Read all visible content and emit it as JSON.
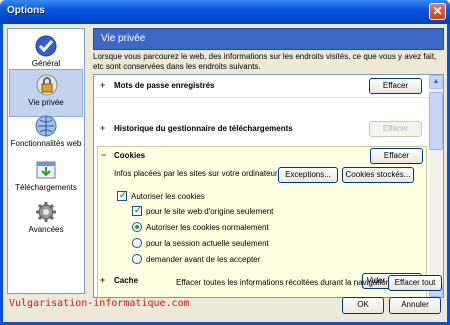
{
  "window": {
    "title": "Options",
    "close_glyph": "✕"
  },
  "sidebar": {
    "items": [
      {
        "label": "Général",
        "icon": "checkmark-icon",
        "selected": false
      },
      {
        "label": "Vie privée",
        "icon": "lock-icon",
        "selected": true
      },
      {
        "label": "Fonctionnalités web",
        "icon": "globe-icon",
        "selected": false
      },
      {
        "label": "Téléchargements",
        "icon": "download-icon",
        "selected": false
      },
      {
        "label": "Avancées",
        "icon": "gear-icon",
        "selected": false
      }
    ]
  },
  "header": {
    "title": "Vie privée"
  },
  "description": "Lorsque vous parcourez le web, des informations sur les endroits visités, ce que vous y avez fait, etc sont conservées dans les endroits suivants.",
  "sections": {
    "passwords": {
      "expander": "+",
      "title": "Mots de passe enregistrés",
      "button": "Effacer"
    },
    "downloads": {
      "expander": "+",
      "title": "Historique du gestionnaire de téléchargements",
      "button": "Effacer"
    },
    "cookies": {
      "expander": "−",
      "title": "Cookies",
      "button": "Effacer",
      "info": "Infos placées par les sites sur votre ordinateur",
      "exceptions_button": "Exceptions...",
      "stored_button": "Cookies stockés...",
      "allow_label": "Autoriser les cookies",
      "origin_label": "pour le site web d'origine seulement",
      "radio_normal": "Autoriser les cookies normalement",
      "radio_session": "pour la session actuelle seulement",
      "radio_ask": "demander avant de les accepter"
    },
    "cache": {
      "expander": "+",
      "title": "Cache",
      "button": "Vider le cache"
    }
  },
  "footer": {
    "clear_label": "Effacer toutes les informations récoltées durant la navigation :",
    "clear_all_button": "Effacer tout",
    "ok_button": "OK",
    "cancel_button": "Annuler"
  },
  "watermark": "Vulgarisation-informatique.com",
  "colors": {
    "accent": "#3d68c9",
    "selection": "#c2d3f0",
    "cookies_bg": "#ffffe1",
    "watermark": "#cc1b1b"
  }
}
